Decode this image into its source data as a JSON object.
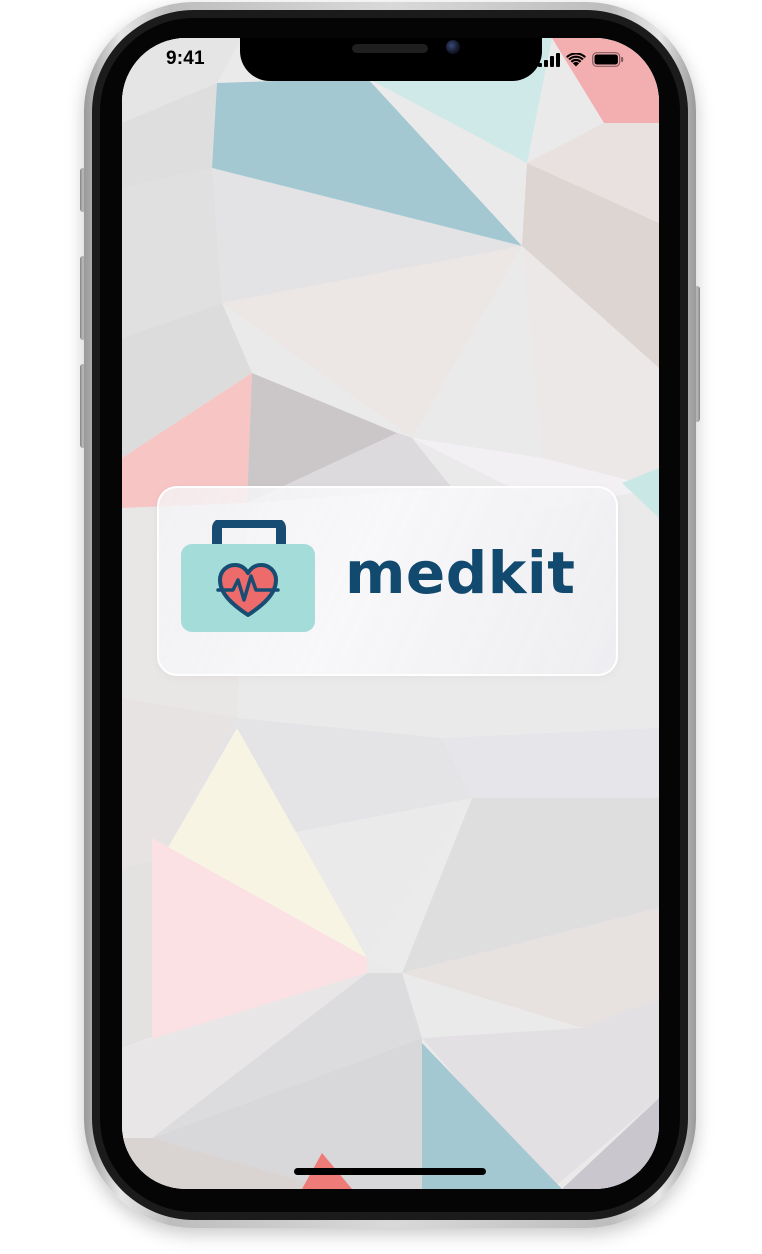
{
  "status_bar": {
    "time": "9:41",
    "icons": [
      "signal-icon",
      "wifi-icon",
      "battery-icon"
    ]
  },
  "app": {
    "name": "medkit",
    "logo_icon": "medical-kit-heart-icon"
  },
  "colors": {
    "brand_navy": "#12496e",
    "kit_teal": "#a3dcd9",
    "heart_coral": "#ee6b6b",
    "bg_teal": "#a3c9d1",
    "bg_pink": "#f7c4c4",
    "bg_cream": "#f8f4e6"
  }
}
